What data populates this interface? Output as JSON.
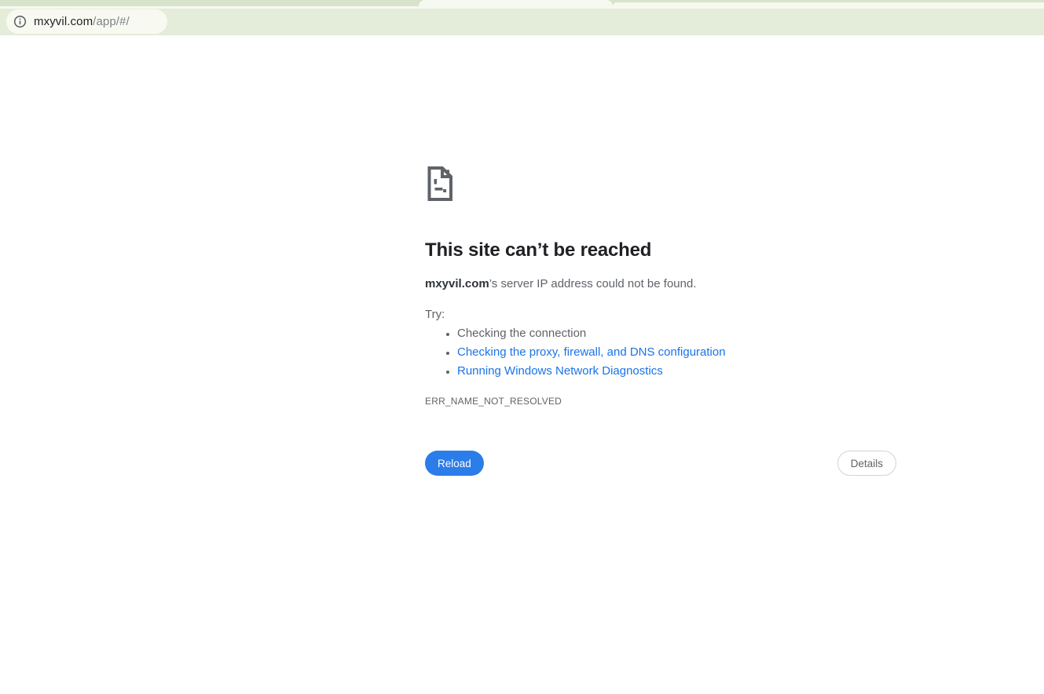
{
  "browser": {
    "url_host": "mxyvil.com",
    "url_path": "/app/#/"
  },
  "error_page": {
    "title": "This site can’t be reached",
    "message_host": "mxyvil.com",
    "message_rest": "’s server IP address could not be found.",
    "try_label": "Try:",
    "suggestions": [
      {
        "label": "Checking the connection",
        "type": "text"
      },
      {
        "label": "Checking the proxy, firewall, and DNS configuration",
        "type": "link"
      },
      {
        "label": "Running Windows Network Diagnostics",
        "type": "link"
      }
    ],
    "error_code": "ERR_NAME_NOT_RESOLVED",
    "reload_label": "Reload",
    "details_label": "Details"
  },
  "colors": {
    "tabstrip_bg": "#d8e3cc",
    "toolbar_bg": "#e4ecda",
    "active_tab_bg": "#f6f9ef",
    "omnibox_bg": "#f8faf2",
    "url_host_color": "#202124",
    "url_path_color": "#7c8287",
    "title_color": "#202124",
    "text_color": "#5f6368",
    "link_color": "#1a73e8",
    "reload_bg": "#2b7de9",
    "reload_text": "#ffffff",
    "details_border": "#d0d4d9",
    "details_text": "#5f6368",
    "icon_stroke": "#5f6368"
  }
}
